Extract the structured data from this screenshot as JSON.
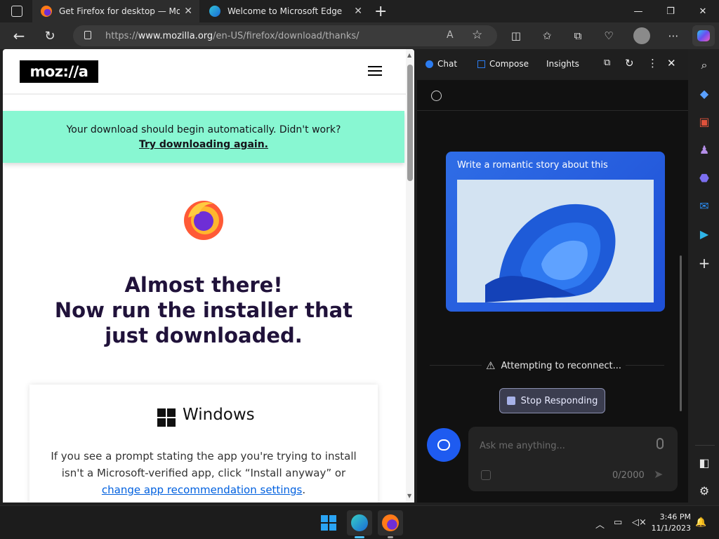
{
  "tabs": [
    {
      "title": "Get Firefox for desktop — Mozill",
      "icon": "firefox-icon",
      "active": true
    },
    {
      "title": "Welcome to Microsoft Edge",
      "icon": "edge-icon",
      "active": false
    }
  ],
  "toolbar": {
    "url_prefix": "https://",
    "url_domain": "www.mozilla.org",
    "url_path": "/en-US/firefox/download/thanks/"
  },
  "page": {
    "logo_text": "moz://a",
    "banner_line1": "Your download should begin automatically. Didn't work?",
    "banner_link": "Try downloading again.",
    "heading_line1": "Almost there!",
    "heading_line2": "Now run the installer that",
    "heading_line3": "just downloaded.",
    "card_title": "Windows",
    "card_text": "If you see a prompt stating the app you're trying to install isn't a Microsoft-verified app, click “Install anyway” or ",
    "card_link": "change app recommendation settings",
    "card_text_end": "."
  },
  "copilot": {
    "tabs": [
      "Chat",
      "Compose",
      "Insights"
    ],
    "user_message": "Write a romantic story about this",
    "status": "Attempting to reconnect...",
    "stop_label": "Stop Responding",
    "input_placeholder": "Ask me anything...",
    "char_count": "0/2000"
  },
  "taskbar": {
    "time": "3:46 PM",
    "date": "11/1/2023"
  },
  "colors": {
    "banner": "#88f7d2",
    "accent": "#1e5bf0",
    "link": "#0060df"
  }
}
